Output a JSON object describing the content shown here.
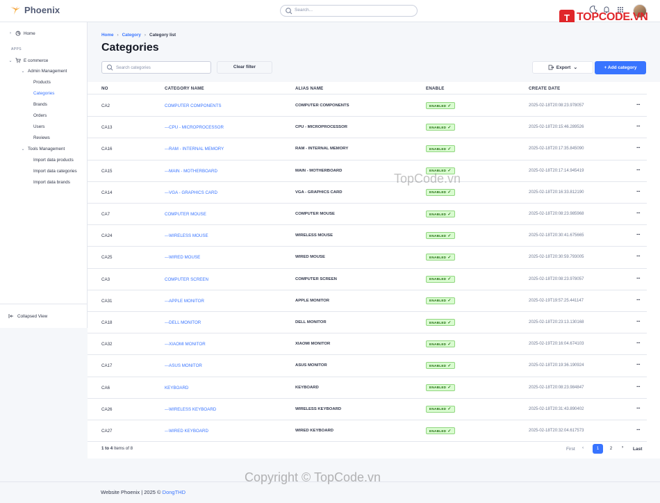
{
  "app": {
    "name": "Phoenix",
    "brand_badge": "TOPCODE.VN"
  },
  "topbar": {
    "search_placeholder": "Search..."
  },
  "sidebar": {
    "home": "Home",
    "section_label": "APPS",
    "ecommerce": "E commerce",
    "admin_management": "Admin Management",
    "admin_items": [
      "Products",
      "Categories",
      "Brands",
      "Orders",
      "Users",
      "Reviews"
    ],
    "tools_management": "Tools Management",
    "tools_items": [
      "Import data products",
      "Import data categories",
      "Import data brands"
    ],
    "collapsed_view": "Collapsed View"
  },
  "breadcrumb": {
    "home": "Home",
    "category": "Category",
    "current": "Category list"
  },
  "page": {
    "title": "Categories",
    "search_placeholder": "Search categories",
    "clear_filter": "Clear filter",
    "export": "Export",
    "add_category": "+ Add category"
  },
  "table": {
    "headers": [
      "NO",
      "CATEGORY NAME",
      "ALIAS NAME",
      "ENABLE",
      "CREATE DATE"
    ],
    "rows": [
      {
        "no": "CA2",
        "name": "COMPUTER COMPONENTS",
        "alias": "COMPUTER COMPONENTS",
        "enable": "ENABLED",
        "date": "2025-02-18T20:08:23.978057"
      },
      {
        "no": "CA13",
        "name": "---CPU - MICROPROCESSOR",
        "alias": "CPU - MICROPROCESSOR",
        "enable": "ENABLED",
        "date": "2025-02-18T20:15:46.289526"
      },
      {
        "no": "CA16",
        "name": "---RAM - INTERNAL MEMORY",
        "alias": "RAM - INTERNAL MEMORY",
        "enable": "ENABLED",
        "date": "2025-02-18T20:17:35.845090"
      },
      {
        "no": "CA15",
        "name": "---MAIN - MOTHERBOARD",
        "alias": "MAIN - MOTHERBOARD",
        "enable": "ENABLED",
        "date": "2025-02-18T20:17:14.945419"
      },
      {
        "no": "CA14",
        "name": "---VGA - GRAPHICS CARD",
        "alias": "VGA - GRAPHICS CARD",
        "enable": "ENABLED",
        "date": "2025-02-18T20:16:33.812190"
      },
      {
        "no": "CA7",
        "name": "COMPUTER MOUSE",
        "alias": "COMPUTER MOUSE",
        "enable": "ENABLED",
        "date": "2025-02-18T20:08:23.985968"
      },
      {
        "no": "CA24",
        "name": "---WIRELESS MOUSE",
        "alias": "WIRELESS MOUSE",
        "enable": "ENABLED",
        "date": "2025-02-18T20:30:41.675665"
      },
      {
        "no": "CA25",
        "name": "---WIRED MOUSE",
        "alias": "WIRED MOUSE",
        "enable": "ENABLED",
        "date": "2025-02-18T20:30:59.793005"
      },
      {
        "no": "CA3",
        "name": "COMPUTER SCREEN",
        "alias": "COMPUTER SCREEN",
        "enable": "ENABLED",
        "date": "2025-02-18T20:08:23.978057"
      },
      {
        "no": "CA31",
        "name": "---APPLE MONITOR",
        "alias": "APPLE MONITOR",
        "enable": "ENABLED",
        "date": "2025-02-19T19:57:25.441147"
      },
      {
        "no": "CA18",
        "name": "---DELL MONITOR",
        "alias": "DELL MONITOR",
        "enable": "ENABLED",
        "date": "2025-02-18T20:23:13.130168"
      },
      {
        "no": "CA32",
        "name": "---XIAOMI MONITOR",
        "alias": "XIAOMI MONITOR",
        "enable": "ENABLED",
        "date": "2025-02-19T20:16:04.674103"
      },
      {
        "no": "CA17",
        "name": "---ASUS MONITOR",
        "alias": "ASUS MONITOR",
        "enable": "ENABLED",
        "date": "2025-02-18T20:19:36.190924"
      },
      {
        "no": "CA6",
        "name": "KEYBOARD",
        "alias": "KEYBOARD",
        "enable": "ENABLED",
        "date": "2025-02-18T20:08:23.984847"
      },
      {
        "no": "CA26",
        "name": "---WIRELESS KEYBOARD",
        "alias": "WIRELESS KEYBOARD",
        "enable": "ENABLED",
        "date": "2025-02-18T20:31:43.890402"
      },
      {
        "no": "CA27",
        "name": "---WIRED KEYBOARD",
        "alias": "WIRED KEYBOARD",
        "enable": "ENABLED",
        "date": "2025-02-18T20:32:04.617573"
      }
    ]
  },
  "pagination": {
    "info_range": "1 to 4",
    "info_rest": "Items of 8",
    "first": "First",
    "pages": [
      "1",
      "2"
    ],
    "last": "Last"
  },
  "watermarks": {
    "center": "TopCode.vn",
    "bottom": "Copyright © TopCode.vn"
  },
  "footer": {
    "text": "Website Phoenix   |  2025 ©",
    "author": "DongTHD"
  },
  "colors": {
    "primary": "#3874ff",
    "success_bg": "#d9fbd0",
    "success_text": "#1c6c09",
    "brand_red": "#e0262a"
  }
}
